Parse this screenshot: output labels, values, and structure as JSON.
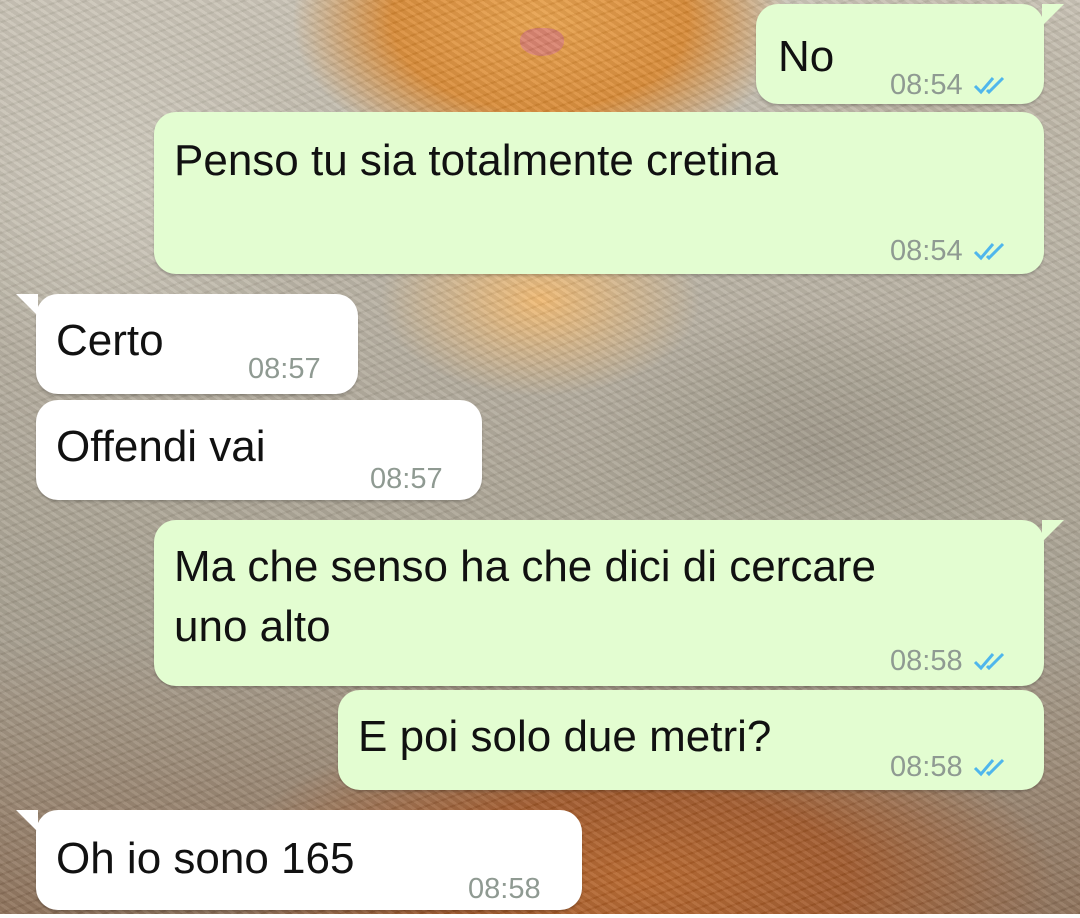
{
  "messages": [
    {
      "direction": "outgoing",
      "text": "No",
      "time": "08:54",
      "status_icon": "double-check-icon"
    },
    {
      "direction": "outgoing",
      "text": "Penso tu sia totalmente cretina",
      "time": "08:54",
      "status_icon": "double-check-icon"
    },
    {
      "direction": "incoming",
      "text": "Certo",
      "time": "08:57"
    },
    {
      "direction": "incoming",
      "text": "Offendi vai",
      "time": "08:57"
    },
    {
      "direction": "outgoing",
      "line1": "Ma che senso ha che dici di cercare",
      "line2": "uno alto",
      "time": "08:58",
      "status_icon": "double-check-icon"
    },
    {
      "direction": "outgoing",
      "text": "E poi solo due metri?",
      "time": "08:58",
      "status_icon": "double-check-icon"
    },
    {
      "direction": "incoming",
      "text": "Oh io sono 165",
      "time": "08:58"
    }
  ],
  "colors": {
    "outgoing_bubble": "#e3fdd1",
    "incoming_bubble": "#ffffff",
    "read_ticks": "#4fb6ec",
    "timestamp": "#8f9a92"
  }
}
